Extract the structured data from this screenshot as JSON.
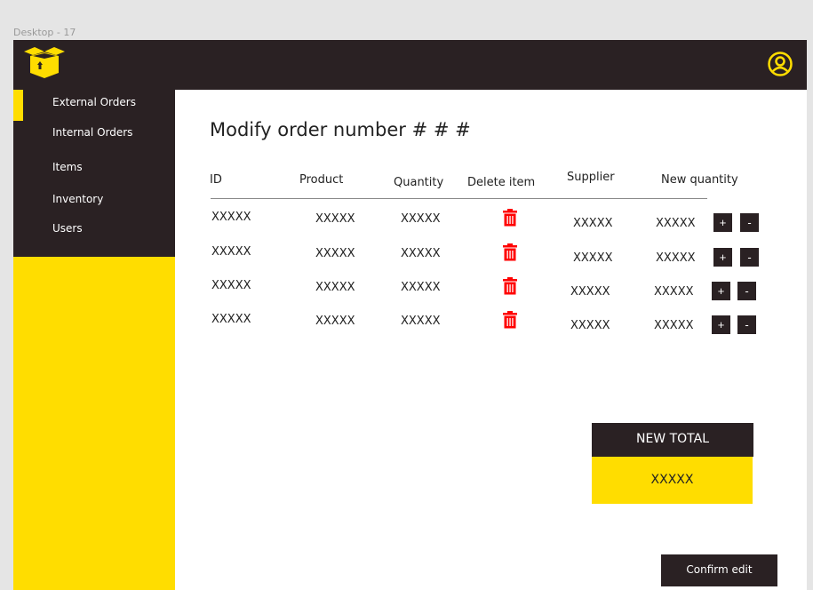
{
  "frame_label": "Desktop - 17",
  "colors": {
    "dark": "#2a2123",
    "accent": "#ffdd00",
    "delete": "#ff0000"
  },
  "sidebar": {
    "items": [
      {
        "label": "External Orders"
      },
      {
        "label": "Internal Orders"
      },
      {
        "label": "Items"
      },
      {
        "label": "Inventory"
      },
      {
        "label": "Users"
      }
    ]
  },
  "title": "Modify order number # # #",
  "table": {
    "headers": {
      "id": "ID",
      "product": "Product",
      "quantity": "Quantity",
      "delete": "Delete item",
      "supplier": "Supplier",
      "new_quantity": "New quantity"
    },
    "rows": [
      {
        "id": "XXXXX",
        "product": "XXXXX",
        "quantity": "XXXXX",
        "supplier": "XXXXX",
        "new_quantity": "XXXXX"
      },
      {
        "id": "XXXXX",
        "product": "XXXXX",
        "quantity": "XXXXX",
        "supplier": "XXXXX",
        "new_quantity": "XXXXX"
      },
      {
        "id": "XXXXX",
        "product": "XXXXX",
        "quantity": "XXXXX",
        "supplier": "XXXXX",
        "new_quantity": "XXXXX"
      },
      {
        "id": "XXXXX",
        "product": "XXXXX",
        "quantity": "XXXXX",
        "supplier": "XXXXX",
        "new_quantity": "XXXXX"
      }
    ],
    "plus_label": "+",
    "minus_label": "-"
  },
  "total": {
    "label": "NEW TOTAL",
    "value": "XXXXX"
  },
  "confirm_label": "Confirm edit"
}
